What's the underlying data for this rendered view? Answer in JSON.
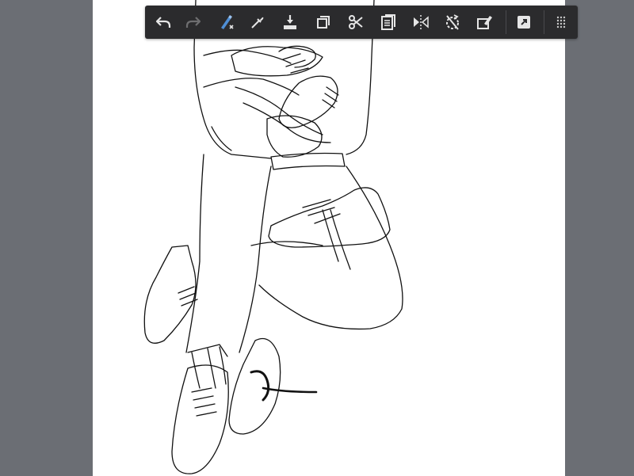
{
  "app": {
    "name": ""
  },
  "toolbar": {
    "items": [
      {
        "icon": "undo-icon",
        "enabled": true
      },
      {
        "icon": "redo-icon",
        "enabled": false
      },
      {
        "icon": "brush-tool-icon",
        "enabled": true
      },
      {
        "icon": "eyedropper-icon",
        "enabled": true
      },
      {
        "icon": "fill-icon",
        "enabled": true
      },
      {
        "icon": "copy-icon",
        "enabled": true
      },
      {
        "icon": "cut-icon",
        "enabled": true
      },
      {
        "icon": "paste-icon",
        "enabled": true
      },
      {
        "icon": "flip-horizontal-icon",
        "enabled": true
      },
      {
        "icon": "rotate-icon",
        "enabled": true
      },
      {
        "icon": "eraser-selection-icon",
        "enabled": true
      },
      {
        "icon": "external-link-icon",
        "enabled": true
      },
      {
        "icon": "more-grip-icon",
        "enabled": true
      }
    ]
  },
  "colors": {
    "workspace": "#6b6e74",
    "canvas": "#ffffff",
    "toolbar": "#2b2b2d",
    "icon": "#e6e6e6",
    "icon_disabled": "#6e6e70",
    "accent": "#4f8fd6"
  }
}
